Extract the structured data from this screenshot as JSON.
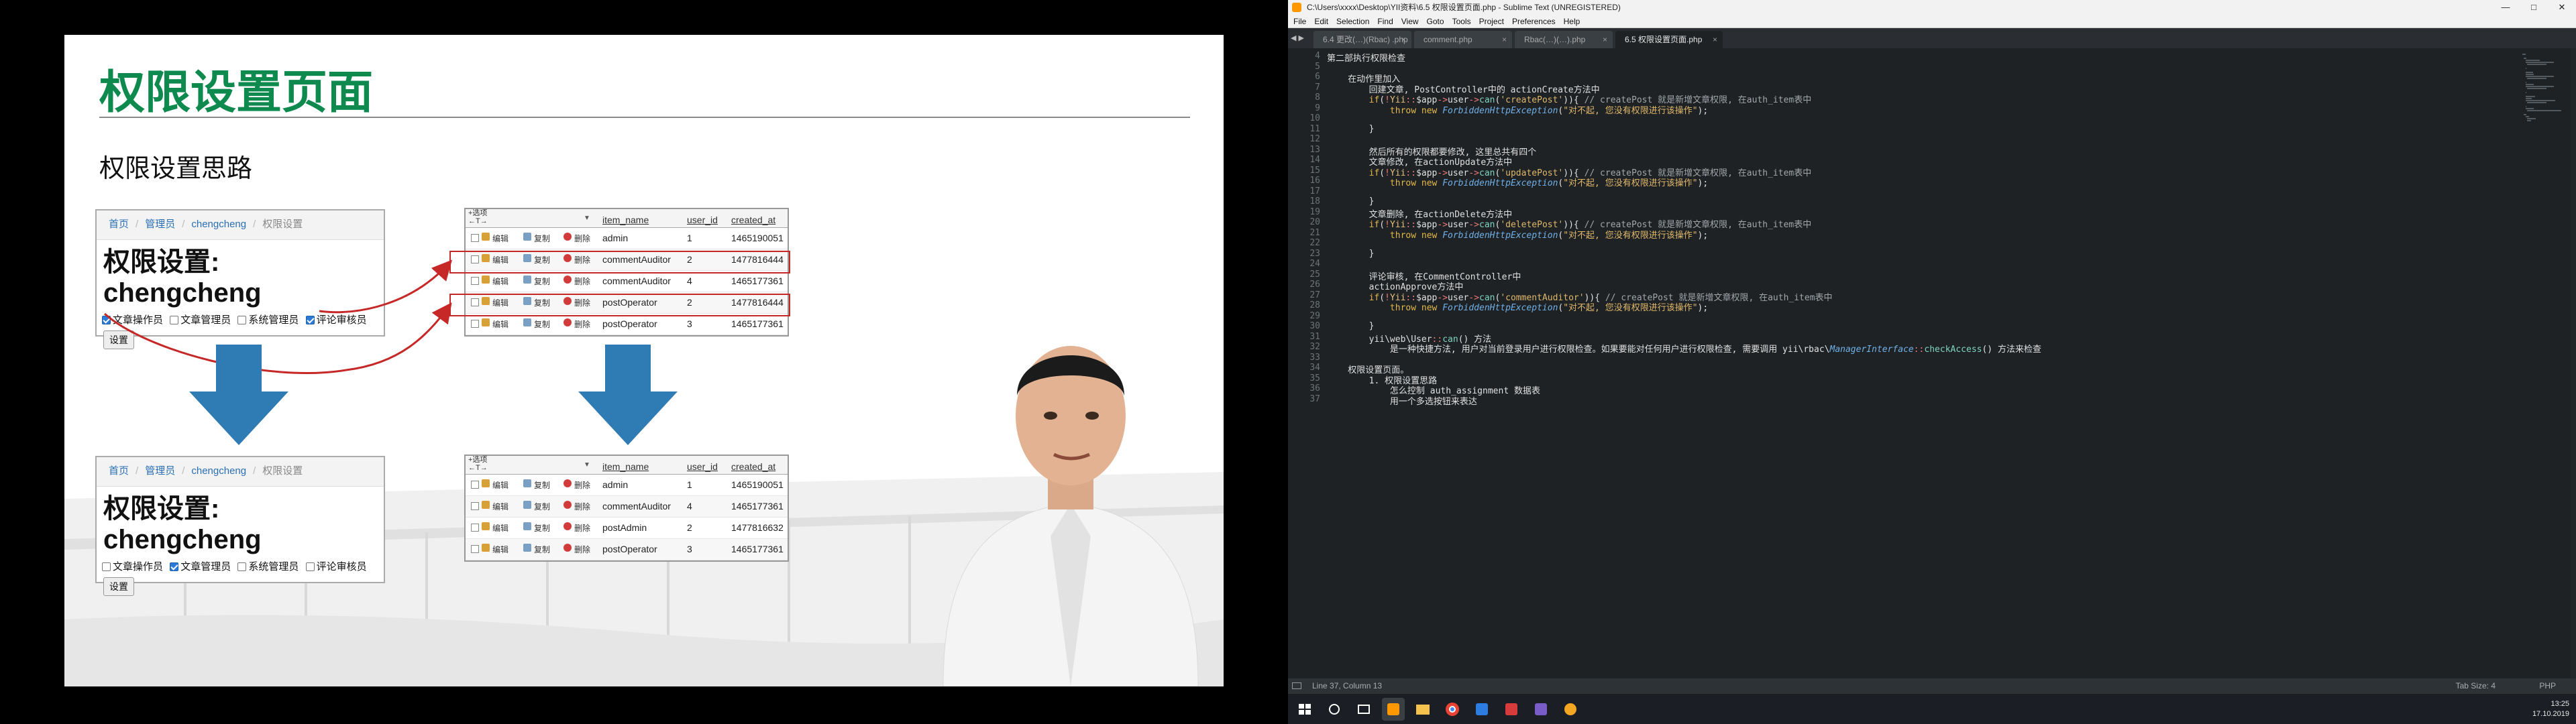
{
  "slide": {
    "title": "权限设置页面",
    "subtitle": "权限设置思路",
    "form_before": {
      "crumbs": [
        "首页",
        "管理员",
        "chengcheng",
        "权限设置"
      ],
      "heading": "权限设置: chengcheng",
      "checks": [
        {
          "label": "文章操作员",
          "checked": true
        },
        {
          "label": "文章管理员",
          "checked": false
        },
        {
          "label": "系统管理员",
          "checked": false
        },
        {
          "label": "评论审核员",
          "checked": true
        }
      ],
      "button": "设置"
    },
    "form_after": {
      "crumbs": [
        "首页",
        "管理员",
        "chengcheng",
        "权限设置"
      ],
      "heading": "权限设置: chengcheng",
      "checks": [
        {
          "label": "文章操作员",
          "checked": false
        },
        {
          "label": "文章管理员",
          "checked": true
        },
        {
          "label": "系统管理员",
          "checked": false
        },
        {
          "label": "评论审核员",
          "checked": false
        }
      ],
      "button": "设置"
    },
    "table_labels": {
      "options": "+选项",
      "arrows": "←T→",
      "edit": "编辑",
      "copy": "复制",
      "delete": "删除"
    },
    "table_before": {
      "headers": [
        "item_name",
        "user_id",
        "created_at"
      ],
      "rows": [
        [
          "admin",
          "1",
          "1465190051"
        ],
        [
          "commentAuditor",
          "2",
          "1477816444"
        ],
        [
          "commentAuditor",
          "4",
          "1465177361"
        ],
        [
          "postOperator",
          "2",
          "1477816444"
        ],
        [
          "postOperator",
          "3",
          "1465177361"
        ]
      ]
    },
    "table_after": {
      "headers": [
        "item_name",
        "user_id",
        "created_at"
      ],
      "rows": [
        [
          "admin",
          "1",
          "1465190051"
        ],
        [
          "commentAuditor",
          "4",
          "1465177361"
        ],
        [
          "postAdmin",
          "2",
          "1477816632"
        ],
        [
          "postOperator",
          "3",
          "1465177361"
        ]
      ]
    }
  },
  "editor": {
    "window_title": "C:\\Users\\xxxx\\Desktop\\YII资料\\6.5 权限设置页面.php - Sublime Text (UNREGISTERED)",
    "menu": [
      "File",
      "Edit",
      "Selection",
      "Find",
      "View",
      "Goto",
      "Tools",
      "Project",
      "Preferences",
      "Help"
    ],
    "tabs": [
      {
        "label": "6.4 更改(…)(Rbac) .php",
        "active": false
      },
      {
        "label": "comment.php",
        "active": false
      },
      {
        "label": "Rbac(…)(…).php",
        "active": false
      },
      {
        "label": "6.5 权限设置页面.php",
        "active": true
      }
    ],
    "first_line_number": 4,
    "lines": [
      "第二部执行权限检查",
      "",
      "    在动作里加入",
      "        回建文章, PostController中的 actionCreate方法中",
      "        if(!Yii::$app->user->can('createPost')){ // createPost 就是新增文章权限, 在auth_item表中",
      "            throw new ForbiddenHttpException(\"对不起, 您没有权限进行该操作\");",
      "",
      "        }",
      "",
      "        然后所有的权限都要修改, 这里总共有四个",
      "        文章修改, 在actionUpdate方法中",
      "        if(!Yii::$app->user->can('updatePost')){ // createPost 就是新增文章权限, 在auth_item表中",
      "            throw new ForbiddenHttpException(\"对不起, 您没有权限进行该操作\");",
      "",
      "        }",
      "        文章删除, 在actionDelete方法中",
      "        if(!Yii::$app->user->can('deletePost')){ // createPost 就是新增文章权限, 在auth_item表中",
      "            throw new ForbiddenHttpException(\"对不起, 您没有权限进行该操作\");",
      "",
      "        }",
      "",
      "        评论审核, 在CommentController中",
      "        actionApprove方法中",
      "        if(!Yii::$app->user->can('commentAuditor')){ // createPost 就是新增文章权限, 在auth_item表中",
      "            throw new ForbiddenHttpException(\"对不起, 您没有权限进行该操作\");",
      "",
      "        }",
      "        yii\\web\\User::can() 方法",
      "            是一种快捷方法, 用户对当前登录用户进行权限检查。如果要能对任何用户进行权限检查, 需要调用 yii\\rbac\\ManagerInterface::checkAccess() 方法来检查",
      "",
      "    权限设置页面。",
      "        1. 权限设置思路",
      "            怎么控制 auth_assignment 数据表",
      "            用一个多选按钮来表达"
    ],
    "status_left": "Line 37, Column 13",
    "status_right": [
      "Tab Size: 4",
      "PHP"
    ]
  },
  "taskbar": {
    "time": "13:25",
    "date": "17.10.2019"
  }
}
